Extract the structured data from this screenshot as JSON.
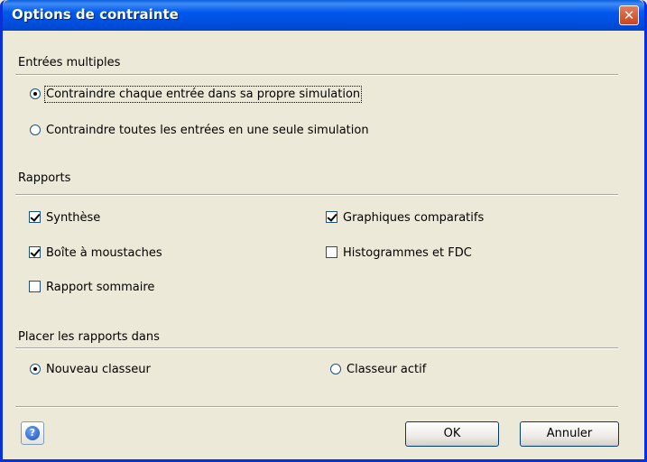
{
  "window": {
    "title": "Options de contrainte"
  },
  "groups": {
    "multiple_inputs": {
      "title": "Entrées multiples",
      "options": [
        {
          "label": "Contraindre chaque entrée dans sa propre simulation",
          "selected": true
        },
        {
          "label": "Contraindre toutes les entrées en une seule simulation",
          "selected": false
        }
      ]
    },
    "reports": {
      "title": "Rapports",
      "items": [
        {
          "label": "Synthèse",
          "checked": true
        },
        {
          "label": "Graphiques comparatifs",
          "checked": true
        },
        {
          "label": "Boîte à moustaches",
          "checked": true
        },
        {
          "label": "Histogrammes et FDC",
          "checked": false
        },
        {
          "label": "Rapport sommaire",
          "checked": false
        }
      ]
    },
    "placement": {
      "title": "Placer les rapports dans",
      "options": [
        {
          "label": "Nouveau classeur",
          "selected": true
        },
        {
          "label": "Classeur actif",
          "selected": false
        }
      ]
    }
  },
  "buttons": {
    "ok": "OK",
    "cancel": "Annuler"
  },
  "icons": {
    "close": "close-icon",
    "help": "help-icon"
  }
}
